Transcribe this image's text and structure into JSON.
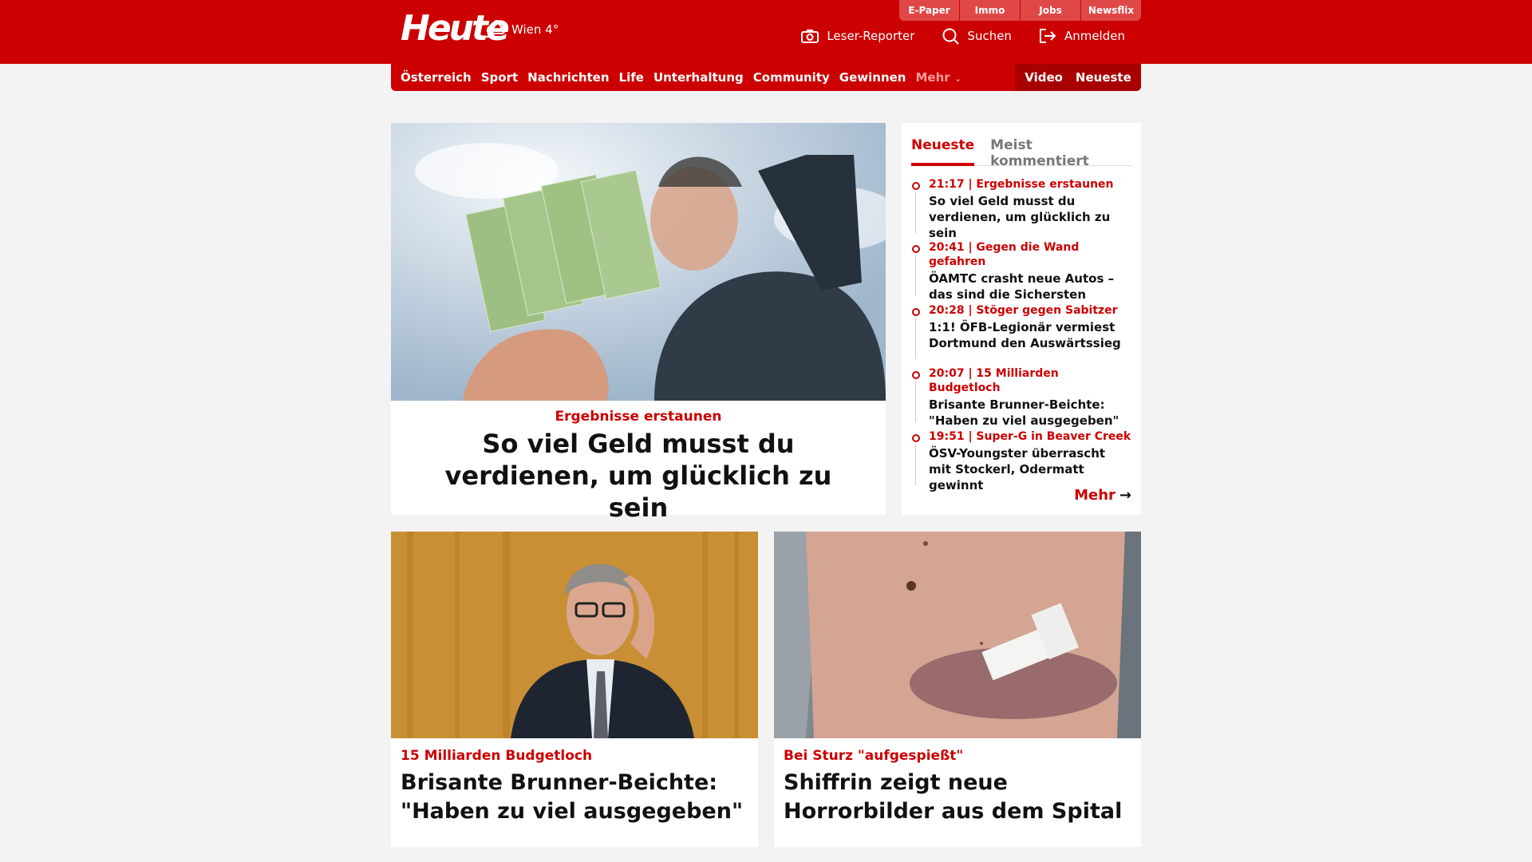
{
  "site": {
    "logo": "Heute",
    "weather": "Wien 4°"
  },
  "topbar": [
    "E-Paper",
    "Immo",
    "Jobs",
    "Newsflix"
  ],
  "header_actions": {
    "reporter": "Leser-Reporter",
    "search": "Suchen",
    "login": "Anmelden"
  },
  "nav": {
    "items": [
      "Österreich",
      "Sport",
      "Nachrichten",
      "Life",
      "Unterhaltung",
      "Community",
      "Gewinnen"
    ],
    "more": "Mehr",
    "video": "Video",
    "neueste": "Neueste"
  },
  "hero": {
    "kicker": "Ergebnisse erstaunen",
    "title": "So viel Geld musst du verdienen, um glücklich zu sein"
  },
  "sidebar": {
    "tabs": [
      "Neueste",
      "Meist kommentiert"
    ],
    "items": [
      {
        "meta": "21:17 | Ergebnisse erstaunen",
        "title": "So viel Geld musst du verdienen, um glücklich zu sein"
      },
      {
        "meta": "20:41 | Gegen die Wand gefahren",
        "title": "ÖAMTC crasht neue Autos – das sind die Sichersten"
      },
      {
        "meta": "20:28 | Stöger gegen Sabitzer",
        "title": "1:1! ÖFB-Legionär vermiest Dortmund den Auswärtssieg"
      },
      {
        "meta": "20:07 | 15 Milliarden Budgetloch",
        "title": "Brisante Brunner-Beichte: \"Haben zu viel ausgegeben\""
      },
      {
        "meta": "19:51 | Super-G in Beaver Creek",
        "title": "ÖSV-Youngster überrascht mit Stockerl, Odermatt gewinnt"
      }
    ],
    "more": "Mehr"
  },
  "cards": [
    {
      "kicker": "15 Milliarden Budgetloch",
      "title": "Brisante Brunner-Beichte: \"Haben zu viel ausgegeben\""
    },
    {
      "kicker": "Bei Sturz \"aufgespießt\"",
      "title": "Shiffrin zeigt neue Horrorbilder aus dem Spital"
    }
  ],
  "colors": {
    "brand": "#cc0000",
    "nav_dark": "#a80000",
    "background": "#f3f3f3"
  }
}
